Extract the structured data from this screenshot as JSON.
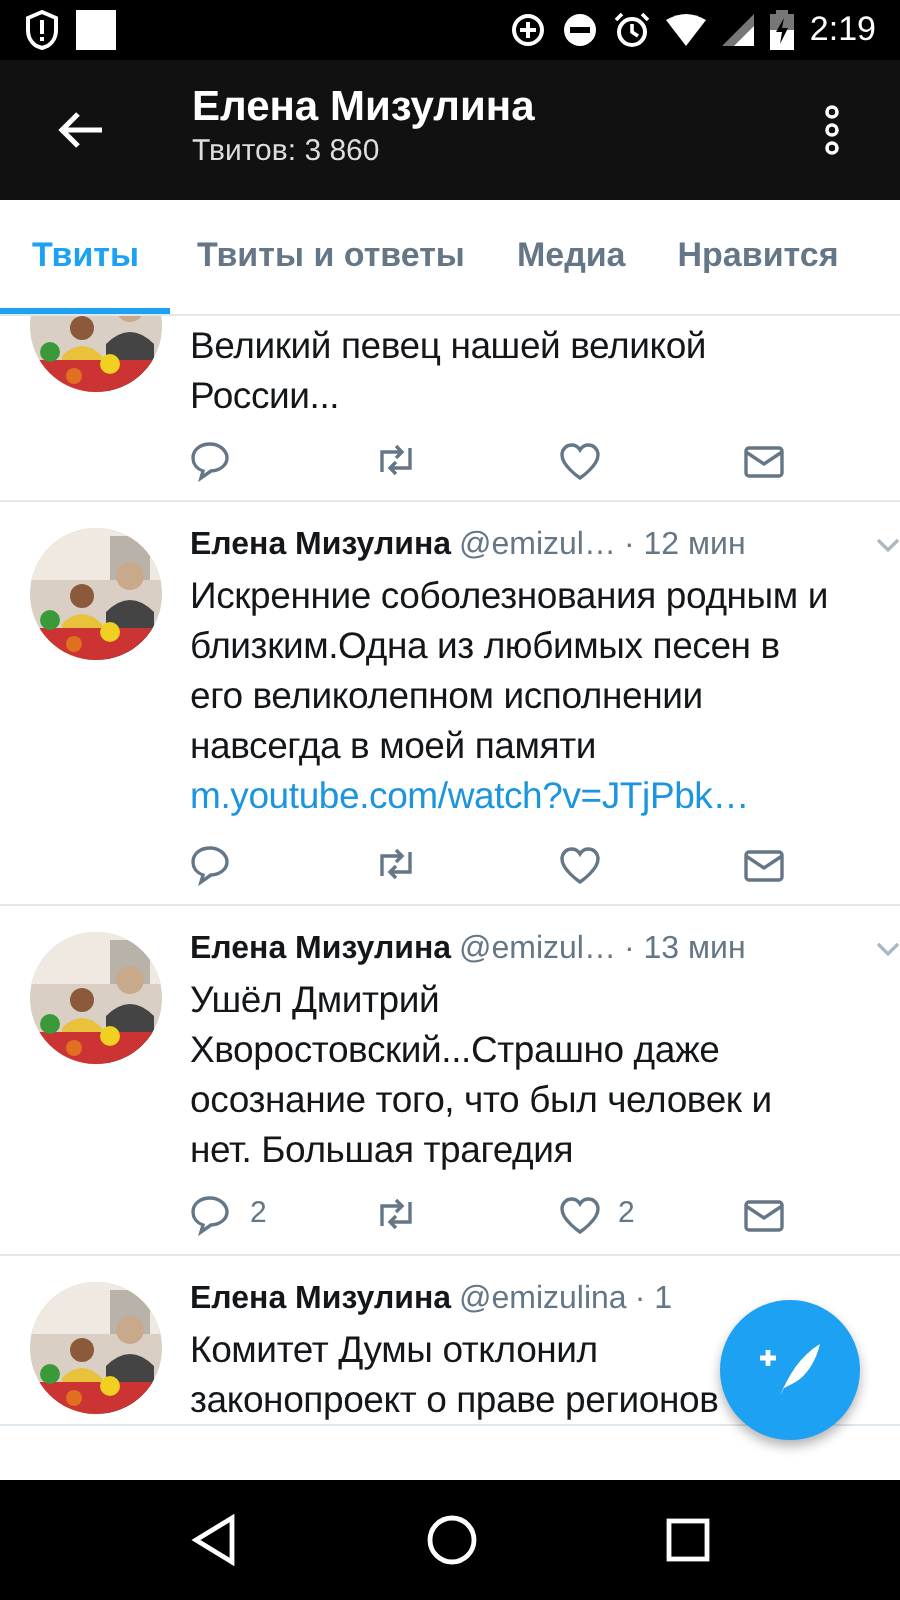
{
  "status_bar": {
    "time": "2:19"
  },
  "header": {
    "title": "Елена Мизулина",
    "subtitle": "Твитов: 3 860"
  },
  "tabs": [
    {
      "label": "Твиты",
      "selected": true
    },
    {
      "label": "Твиты и ответы",
      "selected": false
    },
    {
      "label": "Медиа",
      "selected": false
    },
    {
      "label": "Нравится",
      "selected": false
    }
  ],
  "tweets": [
    {
      "kind": "continued",
      "text": "Великий певец нашей великой России..."
    },
    {
      "kind": "full",
      "author": "Елена Мизулина",
      "handle": "@emizul…",
      "time": "· 12 мин",
      "text": "Искренние соболезнования родным и близким.Одна из любимых песен в его великолепном исполнении навсегда в моей памяти",
      "link": "m.youtube.com/watch?v=JTjPbk…"
    },
    {
      "kind": "full",
      "author": "Елена Мизулина",
      "handle": "@emizul…",
      "time": "· 13 мин",
      "text": "Ушёл Дмитрий Хворостовский...Страшно даже осознание того, что был человек и нет. Большая трагедия",
      "replies": "2",
      "likes": "2"
    },
    {
      "kind": "covered",
      "author": "Елена Мизулина",
      "handle": "@emizulina",
      "time": "· 1",
      "text": "Комитет Думы отклонил законопроект о праве регионов"
    }
  ]
}
